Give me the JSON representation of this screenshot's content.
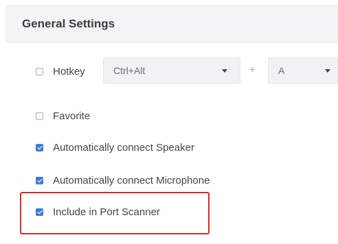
{
  "panel": {
    "title": "General Settings"
  },
  "hotkey": {
    "label": "Hotkey",
    "checked": false,
    "modifier_select": {
      "value": "Ctrl+Alt"
    },
    "separator": "+",
    "key_select": {
      "value": "A"
    }
  },
  "options": [
    {
      "label": "Favorite",
      "checked": false
    },
    {
      "label": "Automatically connect Speaker",
      "checked": true
    },
    {
      "label": "Automatically connect Microphone",
      "checked": true
    },
    {
      "label": "Include in Port Scanner",
      "checked": true
    }
  ],
  "colors": {
    "accent_checkbox": "#3d7fd6",
    "highlight_border": "#d32a2a",
    "header_background": "#f3f4f6"
  },
  "icons": {
    "dropdown": "chevron-down-icon",
    "checkbox": "checkbox-icon"
  }
}
